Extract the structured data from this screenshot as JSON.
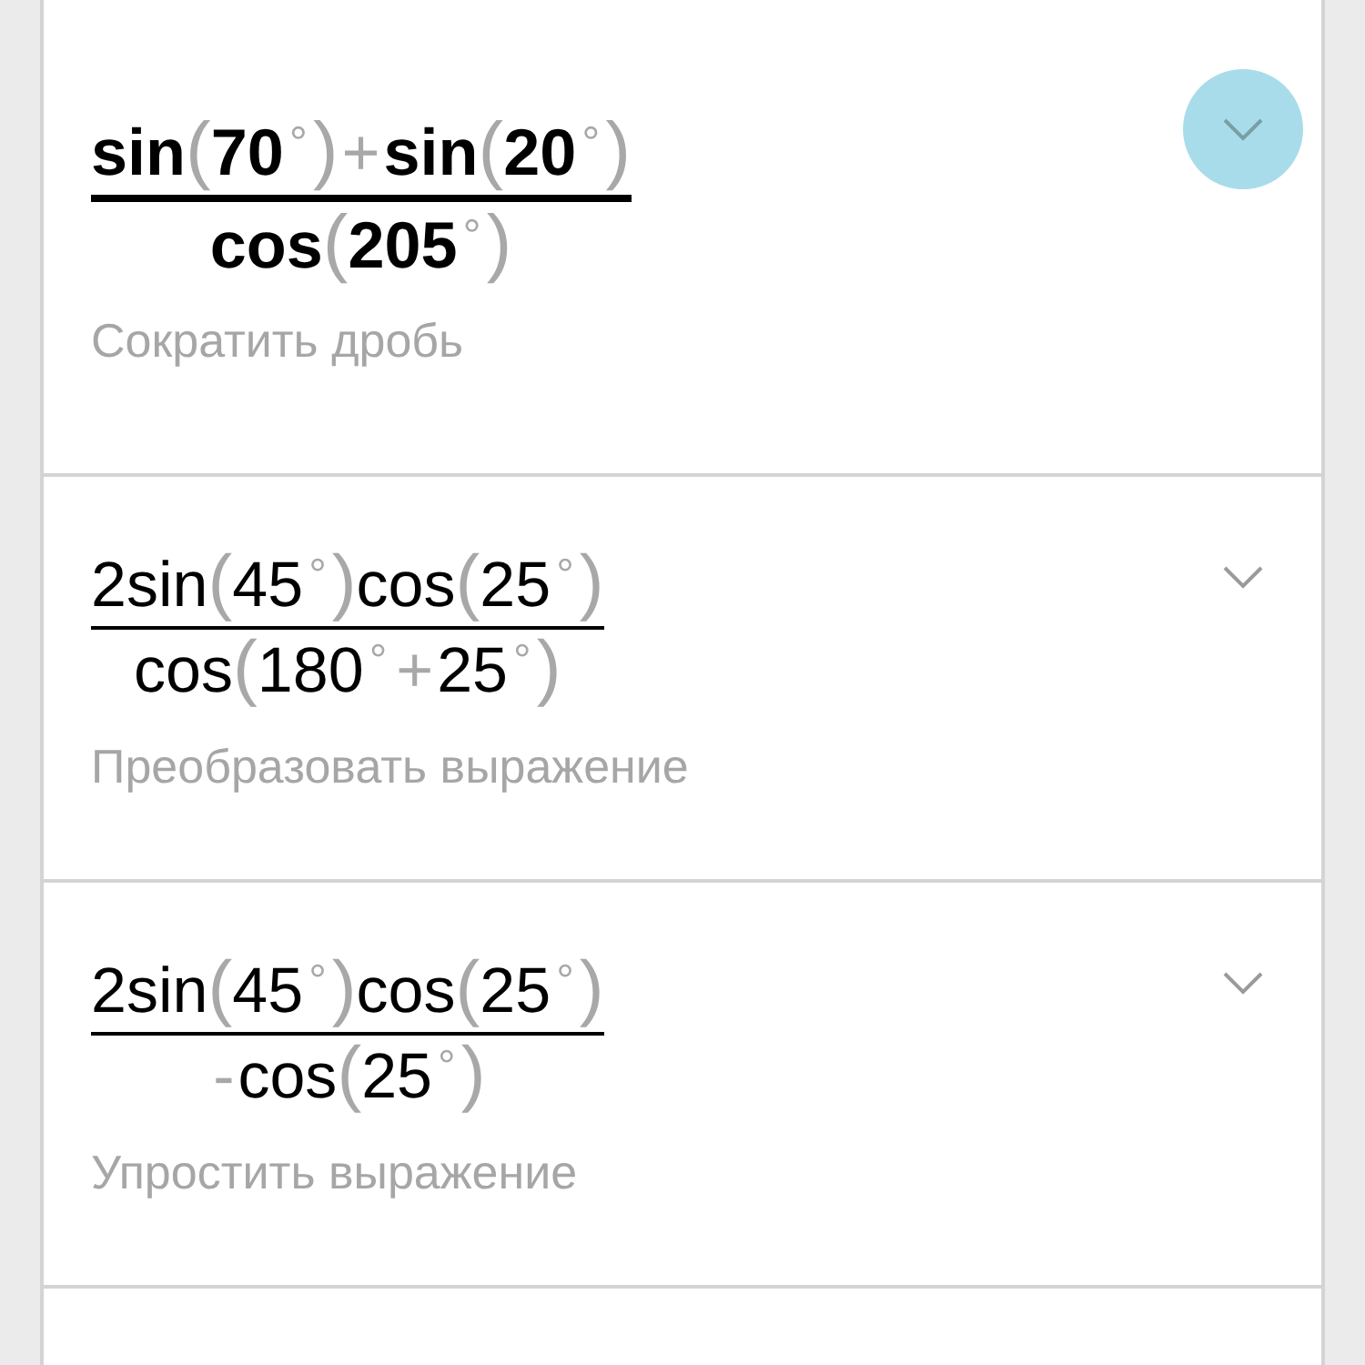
{
  "steps": [
    {
      "highlighted": true,
      "numerator": [
        {
          "kind": "fn",
          "text": "sin"
        },
        {
          "kind": "paren",
          "text": "("
        },
        {
          "kind": "num",
          "text": "70"
        },
        {
          "kind": "deg",
          "text": "°"
        },
        {
          "kind": "paren",
          "text": ")"
        },
        {
          "kind": "op",
          "text": "+"
        },
        {
          "kind": "fn",
          "text": "sin"
        },
        {
          "kind": "paren",
          "text": "("
        },
        {
          "kind": "num",
          "text": "20"
        },
        {
          "kind": "deg",
          "text": "°"
        },
        {
          "kind": "paren",
          "text": ")"
        }
      ],
      "denominator": [
        {
          "kind": "fn",
          "text": "cos"
        },
        {
          "kind": "paren",
          "text": "("
        },
        {
          "kind": "num",
          "text": "205"
        },
        {
          "kind": "deg",
          "text": "°"
        },
        {
          "kind": "paren",
          "text": ")"
        }
      ],
      "description": "Сократить дробь"
    },
    {
      "highlighted": false,
      "numerator": [
        {
          "kind": "num",
          "text": "2"
        },
        {
          "kind": "fn",
          "text": "sin"
        },
        {
          "kind": "paren",
          "text": "("
        },
        {
          "kind": "num",
          "text": "45"
        },
        {
          "kind": "deg",
          "text": "°"
        },
        {
          "kind": "paren",
          "text": ")"
        },
        {
          "kind": "fn",
          "text": "cos"
        },
        {
          "kind": "paren",
          "text": "("
        },
        {
          "kind": "num",
          "text": "25"
        },
        {
          "kind": "deg",
          "text": "°"
        },
        {
          "kind": "paren",
          "text": ")"
        }
      ],
      "denominator": [
        {
          "kind": "fn",
          "text": "cos"
        },
        {
          "kind": "paren",
          "text": "("
        },
        {
          "kind": "num",
          "text": "180"
        },
        {
          "kind": "deg",
          "text": "°"
        },
        {
          "kind": "op",
          "text": "+"
        },
        {
          "kind": "num",
          "text": "25"
        },
        {
          "kind": "deg",
          "text": "°"
        },
        {
          "kind": "paren",
          "text": ")"
        }
      ],
      "description": "Преобразовать выражение"
    },
    {
      "highlighted": false,
      "numerator": [
        {
          "kind": "num",
          "text": "2"
        },
        {
          "kind": "fn",
          "text": "sin"
        },
        {
          "kind": "paren",
          "text": "("
        },
        {
          "kind": "num",
          "text": "45"
        },
        {
          "kind": "deg",
          "text": "°"
        },
        {
          "kind": "paren",
          "text": ")"
        },
        {
          "kind": "fn",
          "text": "cos"
        },
        {
          "kind": "paren",
          "text": "("
        },
        {
          "kind": "num",
          "text": "25"
        },
        {
          "kind": "deg",
          "text": "°"
        },
        {
          "kind": "paren",
          "text": ")"
        }
      ],
      "denominator": [
        {
          "kind": "op",
          "text": "-"
        },
        {
          "kind": "fn",
          "text": "cos"
        },
        {
          "kind": "paren",
          "text": "("
        },
        {
          "kind": "num",
          "text": "25"
        },
        {
          "kind": "deg",
          "text": "°"
        },
        {
          "kind": "paren",
          "text": ")"
        }
      ],
      "description": "Упростить выражение"
    }
  ]
}
